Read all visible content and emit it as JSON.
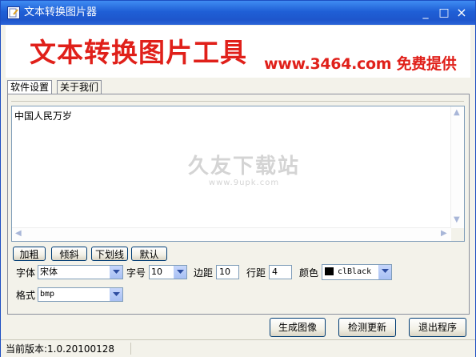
{
  "window": {
    "title": "文本转换图片器",
    "minimize": "_",
    "maximize": "□",
    "close": "×"
  },
  "banner": {
    "title": "文本转换图片工具",
    "url": "www.3464.com 免费提供"
  },
  "tabs": [
    {
      "label": "软件设置",
      "active": true
    },
    {
      "label": "关于我们",
      "active": false
    }
  ],
  "memo": {
    "text": "中国人民万岁"
  },
  "watermark": {
    "text": "久友下载站",
    "url": "www.9upk.com"
  },
  "style_buttons": {
    "bold": "加粗",
    "italic": "倾斜",
    "underline": "下划线",
    "default": "默认"
  },
  "settings": {
    "font_label": "字体",
    "font_value": "宋体",
    "size_label": "字号",
    "size_value": "10",
    "margin_label": "边距",
    "margin_value": "10",
    "spacing_label": "行距",
    "spacing_value": "4",
    "color_label": "颜色",
    "color_value": "clBlack",
    "format_label": "格式",
    "format_value": "bmp"
  },
  "actions": {
    "generate": "生成图像",
    "check_update": "检测更新",
    "exit": "退出程序"
  },
  "status": {
    "version": "当前版本:1.0.20100128"
  },
  "colors": {
    "title_bar": "#1f5fd6",
    "banner_red": "#e0201a",
    "selected_color": "#000000"
  }
}
